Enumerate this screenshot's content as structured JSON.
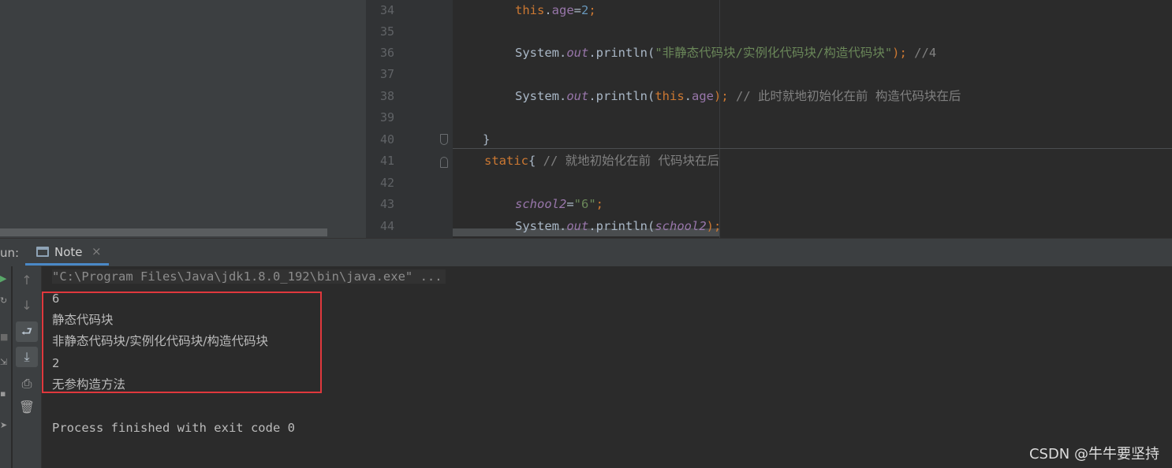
{
  "editor": {
    "line_numbers": [
      "34",
      "35",
      "36",
      "37",
      "38",
      "39",
      "40",
      "41",
      "42",
      "43",
      "44"
    ],
    "lines": {
      "l34": {
        "t1": "this",
        "t2": ".",
        "t3": "age",
        "t4": "=",
        "t5": "2",
        "t6": ";"
      },
      "l36": {
        "t1": "System.",
        "t2": "out",
        "t3": ".println(",
        "t4": "\"非静态代码块/实例化代码块/构造代码块\"",
        "t5": "); ",
        "t6": "//4"
      },
      "l38": {
        "t1": "System.",
        "t2": "out",
        "t3": ".println(",
        "t4": "this",
        "t5": ".",
        "t6": "age",
        "t7": "); ",
        "t8": "// 此时就地初始化在前 构造代码块在后"
      },
      "l40": {
        "t1": "}"
      },
      "l41": {
        "t1": "static",
        "t2": "{ ",
        "t3": "// 就地初始化在前 代码块在后"
      },
      "l43": {
        "t1": "school2",
        "t2": "=",
        "t3": "\"6\"",
        "t4": ";"
      },
      "l44": {
        "t1": "System.",
        "t2": "out",
        "t3": ".println(",
        "t4": "school2",
        "t5": ");"
      }
    }
  },
  "run": {
    "label": "un:",
    "tab_label": "Note",
    "tab_close": "×",
    "output": [
      "\"C:\\Program Files\\Java\\jdk1.8.0_192\\bin\\java.exe\" ...",
      "6",
      "静态代码块",
      "非静态代码块/实例化代码块/构造代码块",
      "2",
      "无参构造方法",
      "",
      "Process finished with exit code 0"
    ]
  },
  "toolbar_icons": {
    "left": [
      "run-icon",
      "rerun-icon",
      "stop-icon",
      "restore-icon",
      "layout-icon",
      "pin-icon"
    ],
    "right": [
      "scroll-up-icon",
      "scroll-down-icon",
      "soft-wrap-icon",
      "scroll-to-end-icon",
      "print-icon",
      "trash-icon"
    ]
  },
  "watermark": "CSDN @牛牛要坚持",
  "colors": {
    "keyword": "#cc7832",
    "field": "#9876aa",
    "string": "#6a8759",
    "number": "#6897bb",
    "comment": "#808080",
    "highlight_border": "#e0383d",
    "tab_underline": "#4a88c7"
  }
}
